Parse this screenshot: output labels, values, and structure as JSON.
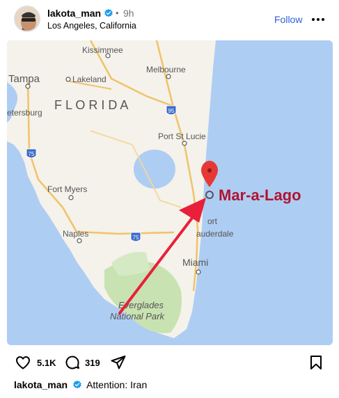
{
  "post": {
    "username": "lakota_man",
    "time_separator": "•",
    "time": "9h",
    "location": "Los Angeles, California",
    "follow_label": "Follow"
  },
  "map": {
    "labels": {
      "kissimmee": "Kissimmee",
      "tampa": "Tampa",
      "lakeland": "Lakeland",
      "melbourne": "Melbourne",
      "florida": "F L O R I D A",
      "petersburg": "etersburg",
      "port_st_lucie": "Port St Lucie",
      "fort_myers": "Fort Myers",
      "naples": "Naples",
      "fort": "ort",
      "lauderdale": "auderdale",
      "miami": "Miami",
      "everglades_1": "Everglades",
      "everglades_2": "National Park",
      "mar_a_lago": "Mar-a-Lago",
      "hwy_95": "95",
      "hwy_75_a": "75",
      "hwy_75_b": "75"
    }
  },
  "actions": {
    "likes": "5.1K",
    "comments": "319"
  },
  "caption": {
    "username": "lakota_man",
    "text": "Attention: Iran"
  },
  "colors": {
    "accent": "#2e5fd8",
    "verified": "#1d9bf0",
    "pin": "#e53935",
    "arrow": "#e8203a",
    "label": "#b01432",
    "water": "#aecdf3",
    "land": "#f4f2ea",
    "park": "#c8e2b2"
  }
}
